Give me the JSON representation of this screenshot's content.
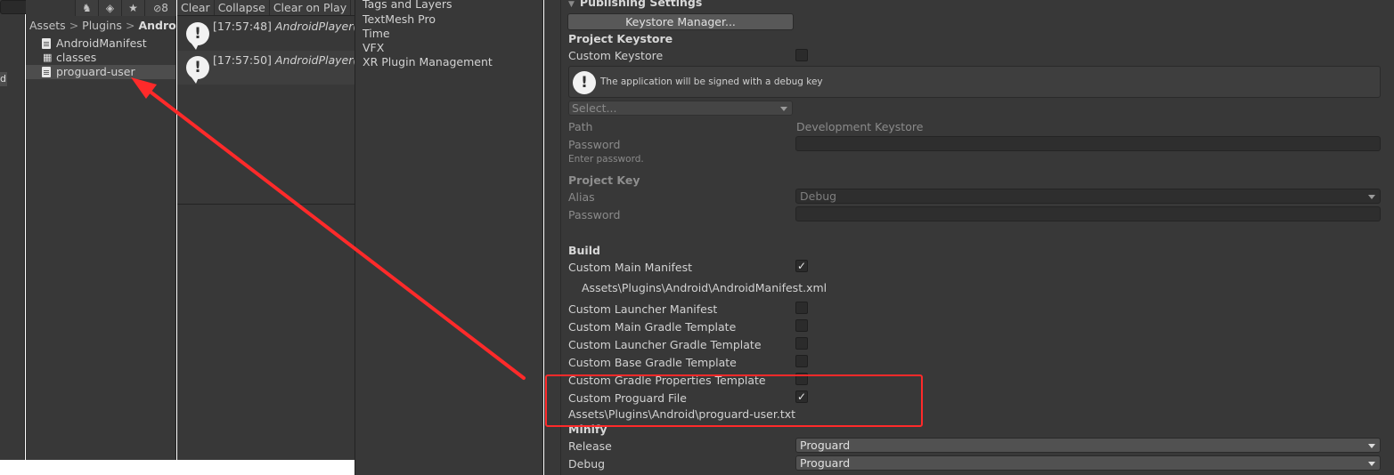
{
  "project": {
    "breadcrumb": [
      "Assets",
      "Plugins",
      "Android"
    ],
    "breadcrumb_sep": ">",
    "files": [
      {
        "name": "AndroidManifest",
        "icon": "text-file-icon"
      },
      {
        "name": "classes",
        "icon": "package-icon"
      },
      {
        "name": "proguard-user",
        "icon": "text-file-icon",
        "selected": true
      }
    ],
    "hidden_count": "8",
    "left_fragment": "d"
  },
  "console": {
    "toolbar": [
      "Clear",
      "Collapse",
      "Clear on Play",
      "Cl"
    ],
    "logs": [
      {
        "time": "[17:57:48]",
        "message": "AndroidPlayer(AD"
      },
      {
        "time": "[17:57:50]",
        "message": "AndroidPlayer(AD"
      }
    ]
  },
  "settings_categories": [
    "Tags and Layers",
    "TextMesh Pro",
    "Time",
    "VFX",
    "XR Plugin Management"
  ],
  "inspector": {
    "publishing_header": "Publishing Settings",
    "keystore_manager_button": "Keystore Manager...",
    "project_keystore_header": "Project Keystore",
    "custom_keystore_label": "Custom Keystore",
    "custom_keystore_checked": false,
    "info_text": "The application will be signed with a debug key",
    "select_placeholder": "Select...",
    "path_label": "Path",
    "path_value": "Development Keystore",
    "password_label": "Password",
    "password_hint": "Enter password.",
    "project_key_header": "Project Key",
    "alias_label": "Alias",
    "alias_value": "Debug",
    "key_password_label": "Password",
    "build_header": "Build",
    "custom_main_manifest_label": "Custom Main Manifest",
    "custom_main_manifest_checked": true,
    "manifest_path": "Assets\\Plugins\\Android\\AndroidManifest.xml",
    "build_toggles": [
      {
        "label": "Custom Launcher Manifest",
        "checked": false
      },
      {
        "label": "Custom Main Gradle Template",
        "checked": false
      },
      {
        "label": "Custom Launcher Gradle Template",
        "checked": false
      },
      {
        "label": "Custom Base Gradle Template",
        "checked": false
      },
      {
        "label": "Custom Gradle Properties Template",
        "checked": false
      },
      {
        "label": "Custom Proguard File",
        "checked": true
      }
    ],
    "proguard_path": "Assets\\Plugins\\Android\\proguard-user.txt",
    "minify_header": "Minify",
    "release_label": "Release",
    "release_value": "Proguard",
    "debug_label": "Debug",
    "debug_value": "Proguard"
  },
  "annotation": {
    "color": "#ff2a2a"
  }
}
